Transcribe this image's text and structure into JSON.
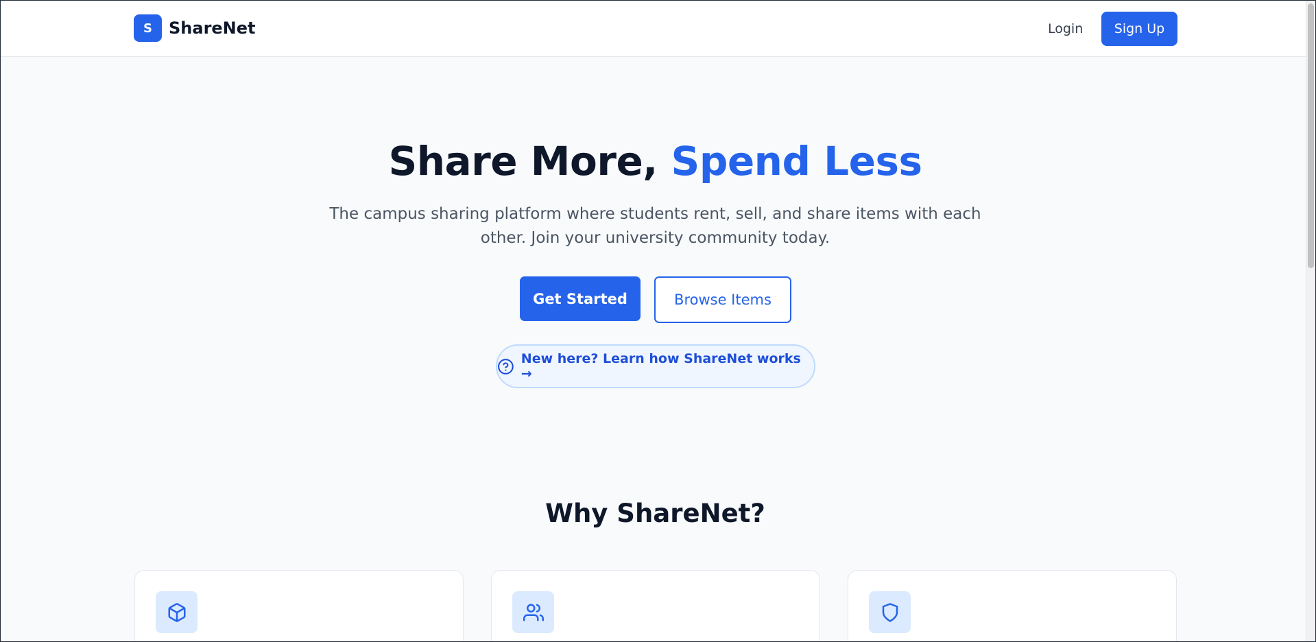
{
  "header": {
    "logo_letter": "S",
    "brand": "ShareNet",
    "login_label": "Login",
    "signup_label": "Sign Up"
  },
  "hero": {
    "title_main": "Share More, ",
    "title_accent": "Spend Less",
    "subtitle_line1": "The campus sharing platform where students rent, sell, and share items with each",
    "subtitle_line2": "other. Join your university community today.",
    "primary_cta": "Get Started",
    "secondary_cta": "Browse Items",
    "learn_link": "New here? Learn how ShareNet works →"
  },
  "features": {
    "title": "Why ShareNet?",
    "cards": [
      {
        "icon": "box-icon"
      },
      {
        "icon": "users-icon"
      },
      {
        "icon": "shield-icon"
      }
    ]
  },
  "colors": {
    "accent": "#2563eb",
    "heading": "#0f172a",
    "background": "#f8fafc"
  }
}
